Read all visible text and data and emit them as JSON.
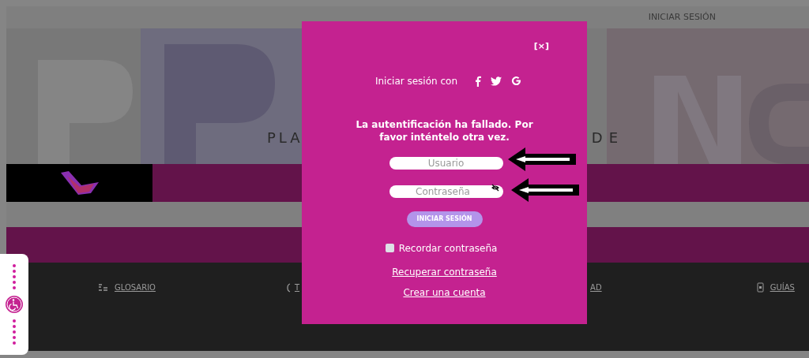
{
  "top_bar": {
    "login_link": "INICIAR SESIÓN"
  },
  "hero": {
    "tagline_left": "PLA",
    "tagline_right": "DE"
  },
  "footer": {
    "links": [
      {
        "label": "GLOSARIO"
      },
      {
        "label": "T"
      },
      {
        "label": "AD"
      },
      {
        "label": "GUÍAS"
      }
    ]
  },
  "login_modal": {
    "close": "[×]",
    "social_label": "Iniciar sesión con",
    "error": "La autentificación ha fallado. Por favor inténtelo otra vez.",
    "username": {
      "placeholder": "Usuario"
    },
    "password": {
      "placeholder": "Contraseña"
    },
    "submit": "INICIAR SESIÓN",
    "remember": {
      "label": "Recordar contraseña",
      "checked": false
    },
    "links": [
      "Recuperar contraseña",
      "Crear una cuenta"
    ]
  }
}
